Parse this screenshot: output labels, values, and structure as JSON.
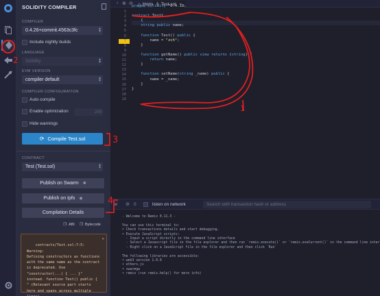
{
  "rail": {
    "icons": [
      "logo-icon",
      "file-explorer-icon",
      "solidity-compiler-icon",
      "deploy-icon",
      "debugger-icon",
      "settings-icon"
    ]
  },
  "panel": {
    "title": "SOLIDITY COMPILER",
    "compiler_label": "COMPILER",
    "compiler_value": "0.4.26+commit.4563c3fc",
    "include_nightly": "Include nightly builds",
    "language_label": "LANGUAGE",
    "language_value": "Solidity",
    "evm_label": "EVM VERSION",
    "evm_value": "compiler default",
    "config_label": "COMPILER CONFIGURATION",
    "auto_compile": "Auto compile",
    "enable_opt": "Enable optimization",
    "opt_runs": "200",
    "hide_warnings": "Hide warnings",
    "compile_button": "Compile Test.sol",
    "contract_label": "CONTRACT",
    "contract_value": "Test (Test.sol)",
    "publish_swarm": "Publish on Swarm",
    "publish_ipfs": "Publish on Ipfs",
    "compilation_details": "Compilation Details",
    "abi": "ABI",
    "bytecode": "Bytecode",
    "warning": "contracts/Test.sol:7:5: Warning:\nDefining constructors as functions\nwith the same name as the contract\nis deprecated. Use\n\"constructor(...) { ... }\"\ninstead. function Test() public {\n^ (Relevant source part starts\nhere and spans across multiple\nlines)."
  },
  "tabs": {
    "home": "Home",
    "file": "Test.sol"
  },
  "editor": {
    "line_numbers": [
      "1",
      "2",
      "3",
      "4",
      "5",
      "6",
      "7",
      "8",
      "9",
      "10",
      "11",
      "12",
      "13",
      "14",
      "15",
      "16",
      "17",
      "18",
      "19"
    ],
    "lines": [
      {
        "n": "1",
        "text": "pragma solidity ^0.4.18;"
      },
      {
        "n": "2",
        "text": ""
      },
      {
        "n": "3",
        "text": "contract Test{"
      },
      {
        "n": "4",
        "text": "    {"
      },
      {
        "n": "5",
        "text": "    string public name;"
      },
      {
        "n": "6",
        "text": ""
      },
      {
        "n": "7",
        "text": "    function Test() public {"
      },
      {
        "n": "8",
        "text": "        name = \"zch\";"
      },
      {
        "n": "9",
        "text": "    }"
      },
      {
        "n": "10",
        "text": ""
      },
      {
        "n": "11",
        "text": "    function getName() public view returns (string) {"
      },
      {
        "n": "12",
        "text": "        return name;"
      },
      {
        "n": "13",
        "text": "    }"
      },
      {
        "n": "14",
        "text": ""
      },
      {
        "n": "15",
        "text": "    function setName(string _name) public {"
      },
      {
        "n": "16",
        "text": "        name = _name;"
      },
      {
        "n": "17",
        "text": "    }"
      },
      {
        "n": "18",
        "text": "}"
      },
      {
        "n": "19",
        "text": ""
      }
    ]
  },
  "terminal": {
    "count": "0",
    "listen": "listen on network",
    "search_placeholder": "Search with transaction hash or address",
    "lines": [
      "- Welcome to Remix 0.11.3 -",
      "",
      "You can use this terminal to:",
      "• Check transactions details and start debugging.",
      "• Execute JavaScript scripts:",
      "  - Input a script directly in the command line interface",
      "  - Select a Javascript file in the file explorer and then run `remix.execute()` or `remix.exeCurrent()` in the command line interface",
      "  - Right click on a JavaScript file in the file explorer and then click `Run`",
      "",
      "The following libraries are accessible:",
      "• web3 version 1.0.0",
      "• ethers.js",
      "• swarmgw",
      "• remix (run remix.help() for more info)"
    ]
  },
  "annotations": {
    "n1": "1",
    "n2": "2",
    "n3": "3",
    "n4": "4"
  }
}
